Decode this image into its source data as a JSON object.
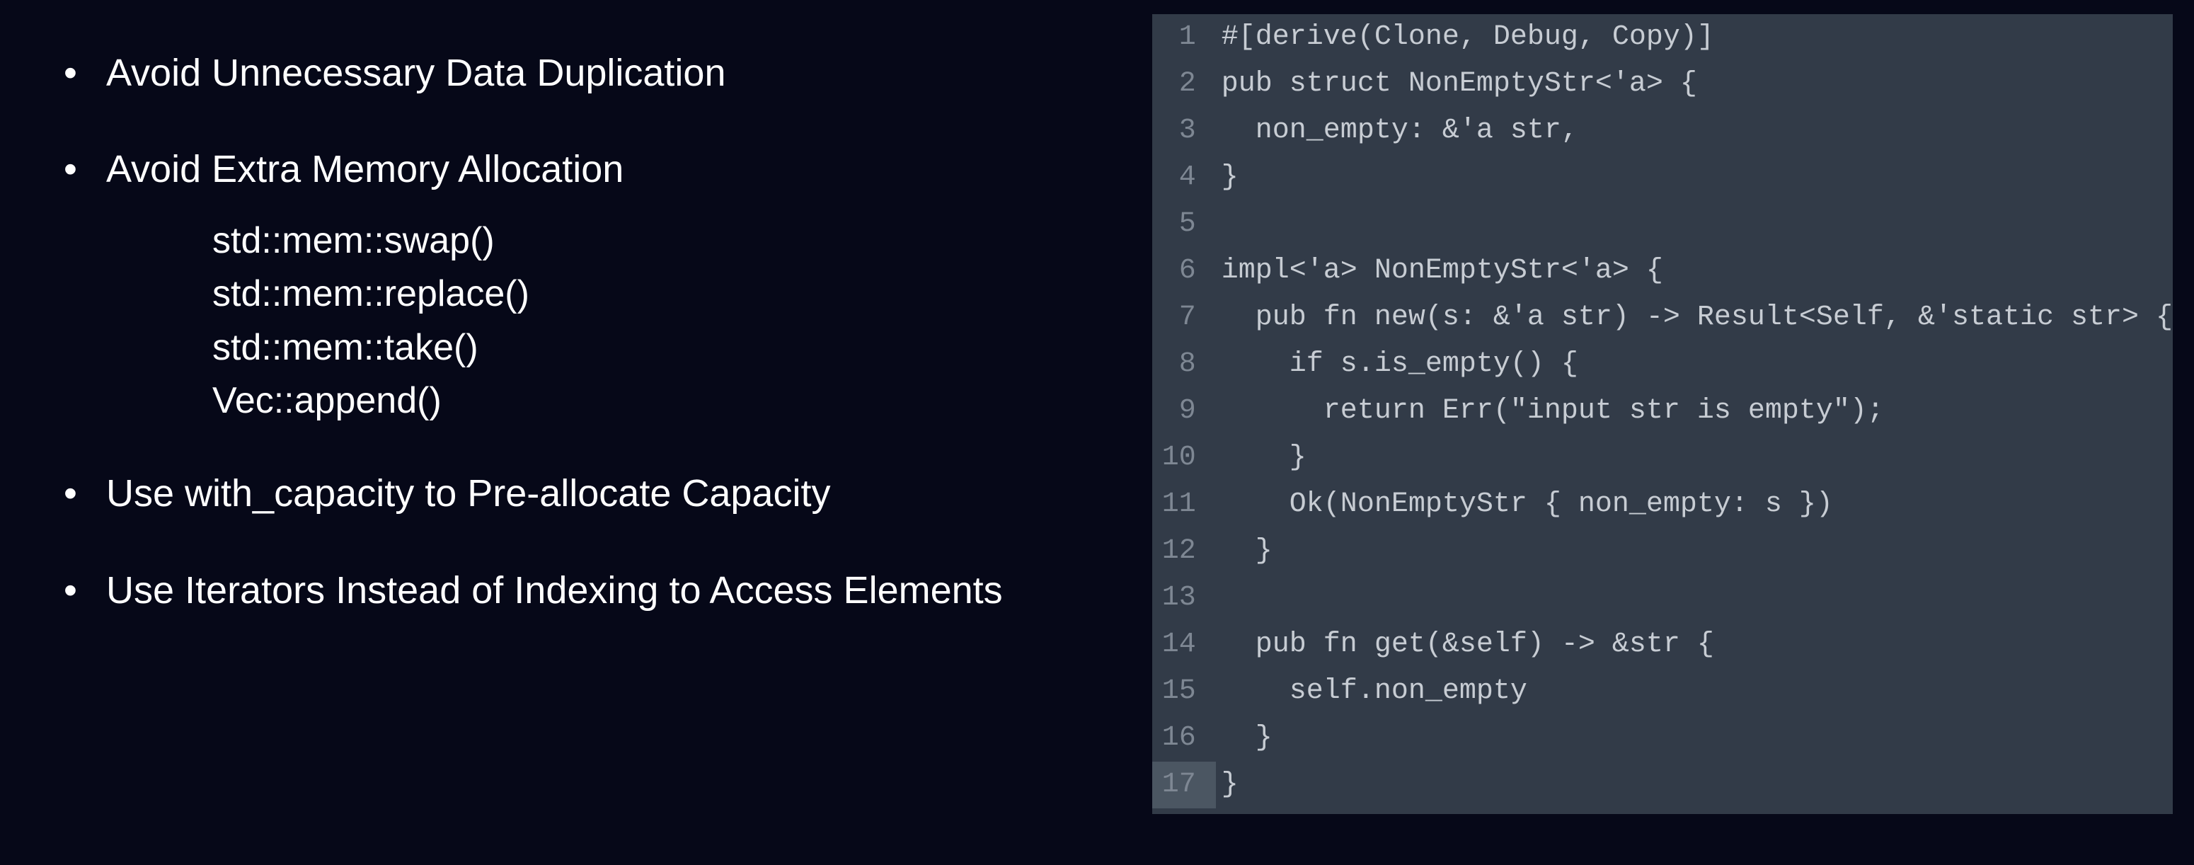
{
  "left": {
    "bullets": [
      {
        "label": "Avoid Unnecessary Data Duplication",
        "subitems": []
      },
      {
        "label": "Avoid Extra Memory Allocation",
        "subitems": [
          "std::mem::swap()",
          "std::mem::replace()",
          "std::mem::take()",
          "Vec::append()"
        ]
      },
      {
        "label": "Use with_capacity to Pre-allocate Capacity",
        "subitems": []
      },
      {
        "label": "Use Iterators Instead of Indexing to Access Elements",
        "subitems": []
      }
    ]
  },
  "code": {
    "lines": [
      "#[derive(Clone, Debug, Copy)]",
      "pub struct NonEmptyStr<'a> {",
      "  non_empty: &'a str,",
      "}",
      "",
      "impl<'a> NonEmptyStr<'a> {",
      "  pub fn new(s: &'a str) -> Result<Self, &'static str> {",
      "    if s.is_empty() {",
      "      return Err(\"input str is empty\");",
      "    }",
      "    Ok(NonEmptyStr { non_empty: s })",
      "  }",
      "",
      "  pub fn get(&self) -> &str {",
      "    self.non_empty",
      "  }",
      "}"
    ],
    "highlight_line": 17
  }
}
